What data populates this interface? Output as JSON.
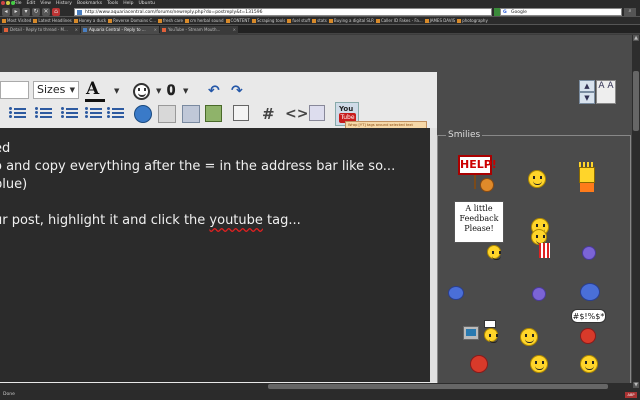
{
  "menubar": {
    "items": [
      "File",
      "Edit",
      "View",
      "History",
      "Bookmarks",
      "Tools",
      "Help",
      "Ubuntu"
    ]
  },
  "navbar": {
    "url": "http://www.aquariacentral.com/forums/newreply.php?do=postreply&t=131596",
    "search_engine": "Google",
    "search_placeholder": "Google"
  },
  "bookmarks": [
    "Most Visited",
    "Latest Headlines",
    "Honey a duck",
    "Reverse Domains C...",
    "fresh care",
    "cm herbal sound",
    "CONTENT",
    "Scraping tools",
    "fuel stuff",
    "stats",
    "Buying a digital SLR",
    "Caller ID Fakes - Fa...",
    "JAMES DAVIS",
    "photography"
  ],
  "tabs": [
    {
      "title": "Detail - Reply to thread - M...",
      "active": false
    },
    {
      "title": "Aquaria Central - Reply to ...",
      "active": true
    },
    {
      "title": "YouTube - Stream Mouth...",
      "active": false
    }
  ],
  "editor": {
    "sizes_label": "Sizes",
    "youtube_you": "You",
    "youtube_tube": "Tube",
    "tooltip": "Wrap [YT] tags around selected text",
    "text_lines": [
      "ed",
      "o and copy everything after the = in the address bar like so...",
      "blue)",
      "",
      "ur post, highlight it and click the ",
      "youtube",
      " tag..."
    ]
  },
  "smilies": {
    "legend": "Smilies",
    "help_sign": "HELP!",
    "feedback_sign": "A little Feedback Please!",
    "hash_sign": "#$!%$*"
  },
  "statusbar": {
    "text": "Done",
    "abp": "ABP"
  },
  "right_tools": {
    "up": "▲",
    "down": "▼",
    "big": "A A"
  }
}
